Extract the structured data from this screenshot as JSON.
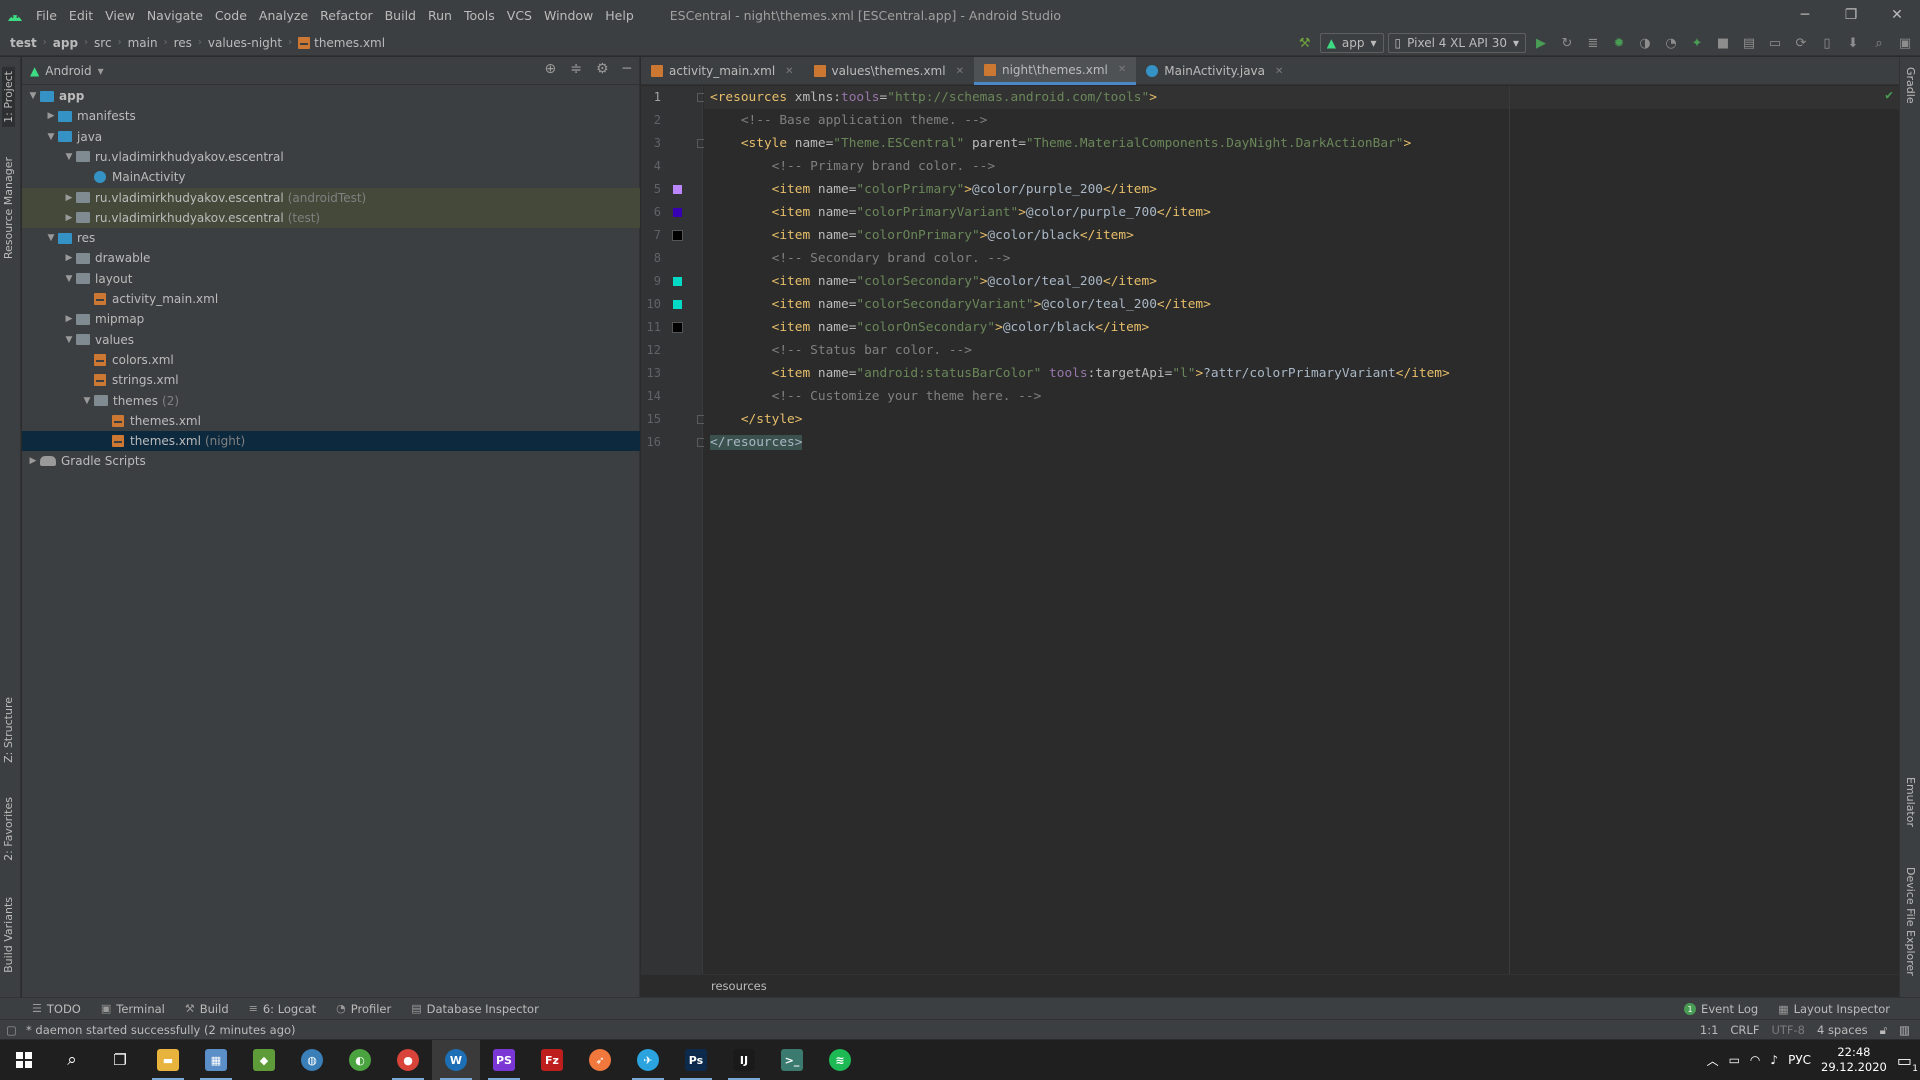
{
  "window": {
    "title": "ESCentral - night\\themes.xml [ESCentral.app] - Android Studio",
    "menu": [
      "File",
      "Edit",
      "View",
      "Navigate",
      "Code",
      "Analyze",
      "Refactor",
      "Build",
      "Run",
      "Tools",
      "VCS",
      "Window",
      "Help"
    ]
  },
  "navbar": {
    "breadcrumbs": [
      "test",
      "app",
      "src",
      "main",
      "res",
      "values-night",
      "themes.xml"
    ],
    "run_config": "app",
    "device": "Pixel 4 XL API 30"
  },
  "left_strip": [
    "1: Project",
    "Resource Manager",
    "Z: Structure",
    "2: Favorites",
    "Build Variants"
  ],
  "right_strip": [
    "Gradle",
    "Emulator",
    "Device File Explorer"
  ],
  "project": {
    "view": "Android",
    "tree": [
      {
        "label": "app",
        "extra": "",
        "depth": 0,
        "arrow": "open",
        "icon": "folder-blue",
        "bold": true
      },
      {
        "label": "manifests",
        "extra": "",
        "depth": 1,
        "arrow": "closed",
        "icon": "folder-blue"
      },
      {
        "label": "java",
        "extra": "",
        "depth": 1,
        "arrow": "open",
        "icon": "folder-blue"
      },
      {
        "label": "ru.vladimirkhudyakov.escentral",
        "extra": "",
        "depth": 2,
        "arrow": "open",
        "icon": "package"
      },
      {
        "label": "MainActivity",
        "extra": "",
        "depth": 3,
        "arrow": "none",
        "icon": "java"
      },
      {
        "label": "ru.vladimirkhudyakov.escentral",
        "extra": "(androidTest)",
        "depth": 2,
        "arrow": "closed",
        "icon": "package",
        "hl": true
      },
      {
        "label": "ru.vladimirkhudyakov.escentral",
        "extra": "(test)",
        "depth": 2,
        "arrow": "closed",
        "icon": "package",
        "hl": true
      },
      {
        "label": "res",
        "extra": "",
        "depth": 1,
        "arrow": "open",
        "icon": "folder-blue"
      },
      {
        "label": "drawable",
        "extra": "",
        "depth": 2,
        "arrow": "closed",
        "icon": "folder"
      },
      {
        "label": "layout",
        "extra": "",
        "depth": 2,
        "arrow": "open",
        "icon": "folder"
      },
      {
        "label": "activity_main.xml",
        "extra": "",
        "depth": 3,
        "arrow": "none",
        "icon": "xml"
      },
      {
        "label": "mipmap",
        "extra": "",
        "depth": 2,
        "arrow": "closed",
        "icon": "folder"
      },
      {
        "label": "values",
        "extra": "",
        "depth": 2,
        "arrow": "open",
        "icon": "folder"
      },
      {
        "label": "colors.xml",
        "extra": "",
        "depth": 3,
        "arrow": "none",
        "icon": "xml"
      },
      {
        "label": "strings.xml",
        "extra": "",
        "depth": 3,
        "arrow": "none",
        "icon": "xml"
      },
      {
        "label": "themes",
        "extra": "(2)",
        "depth": 3,
        "arrow": "open",
        "icon": "folder"
      },
      {
        "label": "themes.xml",
        "extra": "",
        "depth": 4,
        "arrow": "none",
        "icon": "xml"
      },
      {
        "label": "themes.xml",
        "extra": "(night)",
        "depth": 4,
        "arrow": "none",
        "icon": "xml",
        "sel": true
      },
      {
        "label": "Gradle Scripts",
        "extra": "",
        "depth": 0,
        "arrow": "closed",
        "icon": "gradle"
      }
    ]
  },
  "editor": {
    "tabs": [
      {
        "label": "activity_main.xml",
        "type": "xml",
        "active": false
      },
      {
        "label": "values\\themes.xml",
        "type": "xml",
        "active": false
      },
      {
        "label": "night\\themes.xml",
        "type": "xml",
        "active": true
      },
      {
        "label": "MainActivity.java",
        "type": "java",
        "active": false
      }
    ],
    "lines": [
      {
        "n": "1",
        "parts": [
          [
            "tg",
            "<resources "
          ],
          [
            "an",
            "xmlns:"
          ],
          [
            "ns",
            "tools"
          ],
          [
            "an",
            "="
          ],
          [
            "av",
            "\"http://schemas.android.com/tools\""
          ],
          [
            "tg",
            ">"
          ]
        ]
      },
      {
        "n": "2",
        "parts": [
          [
            "tx",
            "    "
          ],
          [
            "cm",
            "<!-- Base application theme. -->"
          ]
        ]
      },
      {
        "n": "3",
        "parts": [
          [
            "tx",
            "    "
          ],
          [
            "tg",
            "<style "
          ],
          [
            "an",
            "name="
          ],
          [
            "av",
            "\"Theme.ESCentral\" "
          ],
          [
            "an",
            "parent="
          ],
          [
            "av",
            "\"Theme.MaterialComponents.DayNight.DarkActionBar\""
          ],
          [
            "tg",
            ">"
          ]
        ]
      },
      {
        "n": "4",
        "parts": [
          [
            "tx",
            "        "
          ],
          [
            "cm",
            "<!-- Primary brand color. -->"
          ]
        ]
      },
      {
        "n": "5",
        "parts": [
          [
            "tx",
            "        "
          ],
          [
            "tg",
            "<item "
          ],
          [
            "an",
            "name="
          ],
          [
            "av",
            "\"colorPrimary\""
          ],
          [
            "tg",
            ">"
          ],
          [
            "tx",
            "@color/purple_200"
          ],
          [
            "tg",
            "</item>"
          ]
        ]
      },
      {
        "n": "6",
        "parts": [
          [
            "tx",
            "        "
          ],
          [
            "tg",
            "<item "
          ],
          [
            "an",
            "name="
          ],
          [
            "av",
            "\"colorPrimaryVariant\""
          ],
          [
            "tg",
            ">"
          ],
          [
            "tx",
            "@color/purple_700"
          ],
          [
            "tg",
            "</item>"
          ]
        ]
      },
      {
        "n": "7",
        "parts": [
          [
            "tx",
            "        "
          ],
          [
            "tg",
            "<item "
          ],
          [
            "an",
            "name="
          ],
          [
            "av",
            "\"colorOnPrimary\""
          ],
          [
            "tg",
            ">"
          ],
          [
            "tx",
            "@color/black"
          ],
          [
            "tg",
            "</item>"
          ]
        ]
      },
      {
        "n": "8",
        "parts": [
          [
            "tx",
            "        "
          ],
          [
            "cm",
            "<!-- Secondary brand color. -->"
          ]
        ]
      },
      {
        "n": "9",
        "parts": [
          [
            "tx",
            "        "
          ],
          [
            "tg",
            "<item "
          ],
          [
            "an",
            "name="
          ],
          [
            "av",
            "\"colorSecondary\""
          ],
          [
            "tg",
            ">"
          ],
          [
            "tx",
            "@color/teal_200"
          ],
          [
            "tg",
            "</item>"
          ]
        ]
      },
      {
        "n": "10",
        "parts": [
          [
            "tx",
            "        "
          ],
          [
            "tg",
            "<item "
          ],
          [
            "an",
            "name="
          ],
          [
            "av",
            "\"colorSecondaryVariant\""
          ],
          [
            "tg",
            ">"
          ],
          [
            "tx",
            "@color/teal_200"
          ],
          [
            "tg",
            "</item>"
          ]
        ]
      },
      {
        "n": "11",
        "parts": [
          [
            "tx",
            "        "
          ],
          [
            "tg",
            "<item "
          ],
          [
            "an",
            "name="
          ],
          [
            "av",
            "\"colorOnSecondary\""
          ],
          [
            "tg",
            ">"
          ],
          [
            "tx",
            "@color/black"
          ],
          [
            "tg",
            "</item>"
          ]
        ]
      },
      {
        "n": "12",
        "parts": [
          [
            "tx",
            "        "
          ],
          [
            "cm",
            "<!-- Status bar color. -->"
          ]
        ]
      },
      {
        "n": "13",
        "parts": [
          [
            "tx",
            "        "
          ],
          [
            "tg",
            "<item "
          ],
          [
            "an",
            "name="
          ],
          [
            "av",
            "\"android:statusBarColor\" "
          ],
          [
            "ns",
            "tools"
          ],
          [
            "an",
            ":targetApi="
          ],
          [
            "av",
            "\"l\""
          ],
          [
            "tg",
            ">"
          ],
          [
            "tx",
            "?attr/colorPrimaryVariant"
          ],
          [
            "tg",
            "</item>"
          ]
        ]
      },
      {
        "n": "14",
        "parts": [
          [
            "tx",
            "        "
          ],
          [
            "cm",
            "<!-- Customize your theme here. -->"
          ]
        ]
      },
      {
        "n": "15",
        "parts": [
          [
            "tx",
            "    "
          ],
          [
            "tg",
            "</style>"
          ]
        ]
      },
      {
        "n": "16",
        "parts": [
          [
            "tgbox",
            "</resources>"
          ]
        ]
      }
    ],
    "swatches": [
      {
        "line": 5,
        "color": "#bb86fc"
      },
      {
        "line": 6,
        "color": "#3700b3"
      },
      {
        "line": 7,
        "color": "#000000"
      },
      {
        "line": 9,
        "color": "#03dac5"
      },
      {
        "line": 10,
        "color": "#03dac5"
      },
      {
        "line": 11,
        "color": "#000000"
      }
    ],
    "breadcrumb": "resources"
  },
  "bottom_tools": {
    "left": [
      {
        "icon": "☰",
        "label": "TODO"
      },
      {
        "icon": "▣",
        "label": "Terminal"
      },
      {
        "icon": "⚒",
        "label": "Build"
      },
      {
        "icon": "≡",
        "label": "6: Logcat"
      },
      {
        "icon": "◔",
        "label": "Profiler"
      },
      {
        "icon": "▤",
        "label": "Database Inspector"
      }
    ],
    "right": [
      {
        "icon": "dot",
        "label": "Event Log",
        "badge": "1"
      },
      {
        "icon": "▦",
        "label": "Layout Inspector"
      }
    ]
  },
  "status": {
    "message": "* daemon started successfully (2 minutes ago)",
    "position": "1:1",
    "line_sep": "CRLF",
    "encoding": "UTF-8",
    "indent": "4 spaces"
  },
  "taskbar": {
    "apps": [
      {
        "name": "explorer",
        "glyph": "▬",
        "color": "#e8b33c",
        "running": true
      },
      {
        "name": "app-2",
        "glyph": "▦",
        "color": "#5b8fc7",
        "running": true
      },
      {
        "name": "app-3",
        "glyph": "◆",
        "color": "#5e9c3a",
        "running": false
      },
      {
        "name": "app-4",
        "glyph": "◍",
        "color": "#3a7fb8",
        "running": false
      },
      {
        "name": "app-5",
        "glyph": "◐",
        "color": "#4aa33f",
        "running": false
      },
      {
        "name": "chrome",
        "glyph": "●",
        "color": "#d9443a",
        "running": true
      },
      {
        "name": "app-7",
        "glyph": "W",
        "color": "#1c6fb5",
        "running": true,
        "active": true
      },
      {
        "name": "phpstorm",
        "glyph": "PS",
        "color": "#7b37d6",
        "running": true
      },
      {
        "name": "filezilla",
        "glyph": "Fz",
        "color": "#bf1e1e",
        "running": false
      },
      {
        "name": "app-10",
        "glyph": "➶",
        "color": "#f0783c",
        "running": false
      },
      {
        "name": "telegram",
        "glyph": "✈",
        "color": "#2aa3de",
        "running": true
      },
      {
        "name": "photoshop",
        "glyph": "Ps",
        "color": "#0c2a4b",
        "running": true
      },
      {
        "name": "intellij",
        "glyph": "IJ",
        "color": "#1a1a1a",
        "running": true
      },
      {
        "name": "terminal",
        "glyph": ">_",
        "color": "#3b7a6f",
        "running": false
      },
      {
        "name": "spotify",
        "glyph": "≋",
        "color": "#1db954",
        "running": false
      }
    ],
    "lang": "РУС",
    "time": "22:48",
    "date": "29.12.2020",
    "notif": "1"
  }
}
